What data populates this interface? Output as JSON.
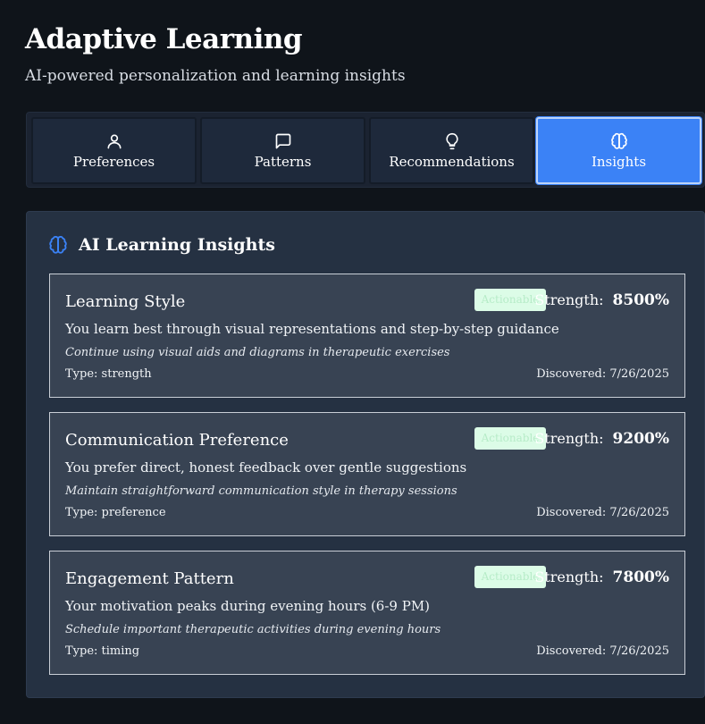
{
  "header": {
    "title": "Adaptive Learning",
    "subtitle": "AI-powered personalization and learning insights"
  },
  "tabs": [
    {
      "label": "Preferences",
      "icon": "user-icon",
      "active": false
    },
    {
      "label": "Patterns",
      "icon": "message-square-icon",
      "active": false
    },
    {
      "label": "Recommendations",
      "icon": "lightbulb-icon",
      "active": false
    },
    {
      "label": "Insights",
      "icon": "brain-icon",
      "active": true
    }
  ],
  "panel": {
    "title": "AI Learning Insights",
    "icon": "brain-icon"
  },
  "insights": [
    {
      "title": "Learning Style",
      "badge": "Actionable",
      "strength_label": "Strength:",
      "strength_value": "8500%",
      "description": "You learn best through visual representations and step-by-step guidance",
      "action": "Continue using visual aids and diagrams in therapeutic exercises",
      "type": "Type: strength",
      "discovered": "Discovered: 7/26/2025"
    },
    {
      "title": "Communication Preference",
      "badge": "Actionable",
      "strength_label": "Strength:",
      "strength_value": "9200%",
      "description": "You prefer direct, honest feedback over gentle suggestions",
      "action": "Maintain straightforward communication style in therapy sessions",
      "type": "Type: preference",
      "discovered": "Discovered: 7/26/2025"
    },
    {
      "title": "Engagement Pattern",
      "badge": "Actionable",
      "strength_label": "Strength:",
      "strength_value": "7800%",
      "description": "Your motivation peaks during evening hours (6-9 PM)",
      "action": "Schedule important therapeutic activities during evening hours",
      "type": "Type: timing",
      "discovered": "Discovered: 7/26/2025"
    }
  ],
  "colors": {
    "background": "#0f141a",
    "accent": "#3b82f6",
    "card": "#384353",
    "badge_bg": "#dcfce7"
  }
}
